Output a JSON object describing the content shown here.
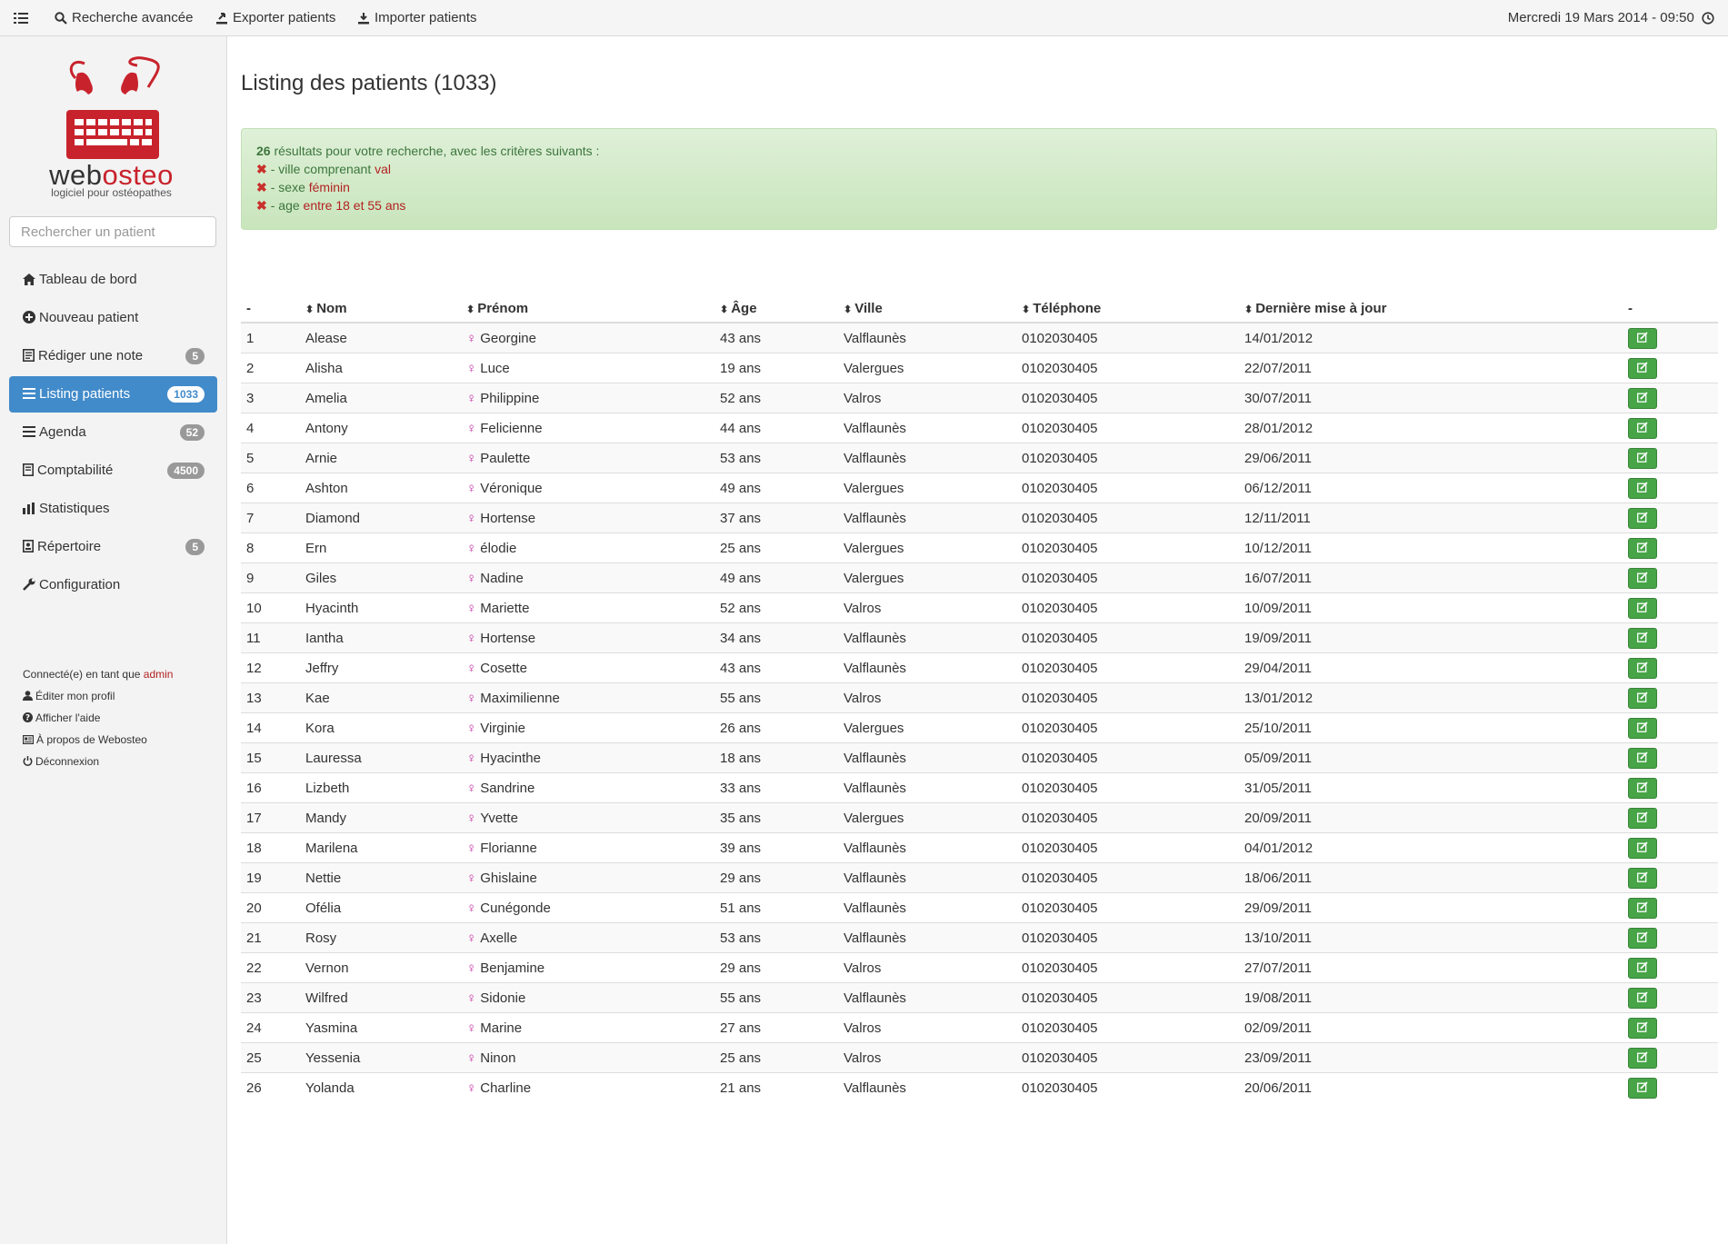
{
  "topbar": {
    "advanced_search": "Recherche avancée",
    "export": "Exporter patients",
    "import": "Importer patients",
    "datetime": "Mercredi 19 Mars 2014 - 09:50"
  },
  "sidebar": {
    "brand_prefix": "web",
    "brand_suffix": "osteo",
    "tagline": "logiciel pour ostéopathes",
    "search_placeholder": "Rechercher un patient",
    "items": [
      {
        "label": "Tableau de bord",
        "badge": null
      },
      {
        "label": "Nouveau patient",
        "badge": null
      },
      {
        "label": "Rédiger une note",
        "badge": "5"
      },
      {
        "label": "Listing patients",
        "badge": "1033"
      },
      {
        "label": "Agenda",
        "badge": "52"
      },
      {
        "label": "Comptabilité",
        "badge": "4500"
      },
      {
        "label": "Statistiques",
        "badge": null
      },
      {
        "label": "Répertoire",
        "badge": "5"
      },
      {
        "label": "Configuration",
        "badge": null
      }
    ],
    "connected_prefix": "Connecté(e) en tant que",
    "user": "admin",
    "links": [
      "Éditer mon profil",
      "Afficher l'aide",
      "À propos de Webosteo",
      "Déconnexion"
    ]
  },
  "main": {
    "title": "Listing des patients (1033)",
    "results": {
      "count": "26",
      "text": "résultats pour votre recherche, avec les critères suivants :",
      "criteria": [
        {
          "label": "- ville comprenant",
          "value": "val"
        },
        {
          "label": "- sexe",
          "value": "féminin"
        },
        {
          "label": "- age",
          "value": "entre 18 et 55 ans"
        }
      ]
    },
    "table": {
      "headers": [
        "-",
        "Nom",
        "Prénom",
        "Âge",
        "Ville",
        "Téléphone",
        "Dernière mise à jour",
        "-"
      ],
      "rows": [
        [
          "1",
          "Alease",
          "Georgine",
          "43 ans",
          "Valflaunès",
          "0102030405",
          "14/01/2012"
        ],
        [
          "2",
          "Alisha",
          "Luce",
          "19 ans",
          "Valergues",
          "0102030405",
          "22/07/2011"
        ],
        [
          "3",
          "Amelia",
          "Philippine",
          "52 ans",
          "Valros",
          "0102030405",
          "30/07/2011"
        ],
        [
          "4",
          "Antony",
          "Felicienne",
          "44 ans",
          "Valflaunès",
          "0102030405",
          "28/01/2012"
        ],
        [
          "5",
          "Arnie",
          "Paulette",
          "53 ans",
          "Valflaunès",
          "0102030405",
          "29/06/2011"
        ],
        [
          "6",
          "Ashton",
          "Véronique",
          "49 ans",
          "Valergues",
          "0102030405",
          "06/12/2011"
        ],
        [
          "7",
          "Diamond",
          "Hortense",
          "37 ans",
          "Valflaunès",
          "0102030405",
          "12/11/2011"
        ],
        [
          "8",
          "Ern",
          "élodie",
          "25 ans",
          "Valergues",
          "0102030405",
          "10/12/2011"
        ],
        [
          "9",
          "Giles",
          "Nadine",
          "49 ans",
          "Valergues",
          "0102030405",
          "16/07/2011"
        ],
        [
          "10",
          "Hyacinth",
          "Mariette",
          "52 ans",
          "Valros",
          "0102030405",
          "10/09/2011"
        ],
        [
          "11",
          "Iantha",
          "Hortense",
          "34 ans",
          "Valflaunès",
          "0102030405",
          "19/09/2011"
        ],
        [
          "12",
          "Jeffry",
          "Cosette",
          "43 ans",
          "Valflaunès",
          "0102030405",
          "29/04/2011"
        ],
        [
          "13",
          "Kae",
          "Maximilienne",
          "55 ans",
          "Valros",
          "0102030405",
          "13/01/2012"
        ],
        [
          "14",
          "Kora",
          "Virginie",
          "26 ans",
          "Valergues",
          "0102030405",
          "25/10/2011"
        ],
        [
          "15",
          "Lauressa",
          "Hyacinthe",
          "18 ans",
          "Valflaunès",
          "0102030405",
          "05/09/2011"
        ],
        [
          "16",
          "Lizbeth",
          "Sandrine",
          "33 ans",
          "Valflaunès",
          "0102030405",
          "31/05/2011"
        ],
        [
          "17",
          "Mandy",
          "Yvette",
          "35 ans",
          "Valergues",
          "0102030405",
          "20/09/2011"
        ],
        [
          "18",
          "Marilena",
          "Florianne",
          "39 ans",
          "Valflaunès",
          "0102030405",
          "04/01/2012"
        ],
        [
          "19",
          "Nettie",
          "Ghislaine",
          "29 ans",
          "Valflaunès",
          "0102030405",
          "18/06/2011"
        ],
        [
          "20",
          "Ofélia",
          "Cunégonde",
          "51 ans",
          "Valflaunès",
          "0102030405",
          "29/09/2011"
        ],
        [
          "21",
          "Rosy",
          "Axelle",
          "53 ans",
          "Valflaunès",
          "0102030405",
          "13/10/2011"
        ],
        [
          "22",
          "Vernon",
          "Benjamine",
          "29 ans",
          "Valros",
          "0102030405",
          "27/07/2011"
        ],
        [
          "23",
          "Wilfred",
          "Sidonie",
          "55 ans",
          "Valflaunès",
          "0102030405",
          "19/08/2011"
        ],
        [
          "24",
          "Yasmina",
          "Marine",
          "27 ans",
          "Valros",
          "0102030405",
          "02/09/2011"
        ],
        [
          "25",
          "Yessenia",
          "Ninon",
          "25 ans",
          "Valros",
          "0102030405",
          "23/09/2011"
        ],
        [
          "26",
          "Yolanda",
          "Charline",
          "21 ans",
          "Valflaunès",
          "0102030405",
          "20/06/2011"
        ]
      ]
    }
  },
  "colors": {
    "accent_blue": "#428bca",
    "brand_red": "#c8232c",
    "success_green": "#47a447",
    "alert_bg": "#dff0d8",
    "female_icon": "#c42fa3"
  },
  "icons": {
    "menu": "list-icon",
    "search": "search-icon",
    "export": "export-icon",
    "import": "import-icon",
    "clock": "clock-icon",
    "edit": "edit-icon",
    "female": "venus-icon",
    "remove": "remove-icon"
  }
}
